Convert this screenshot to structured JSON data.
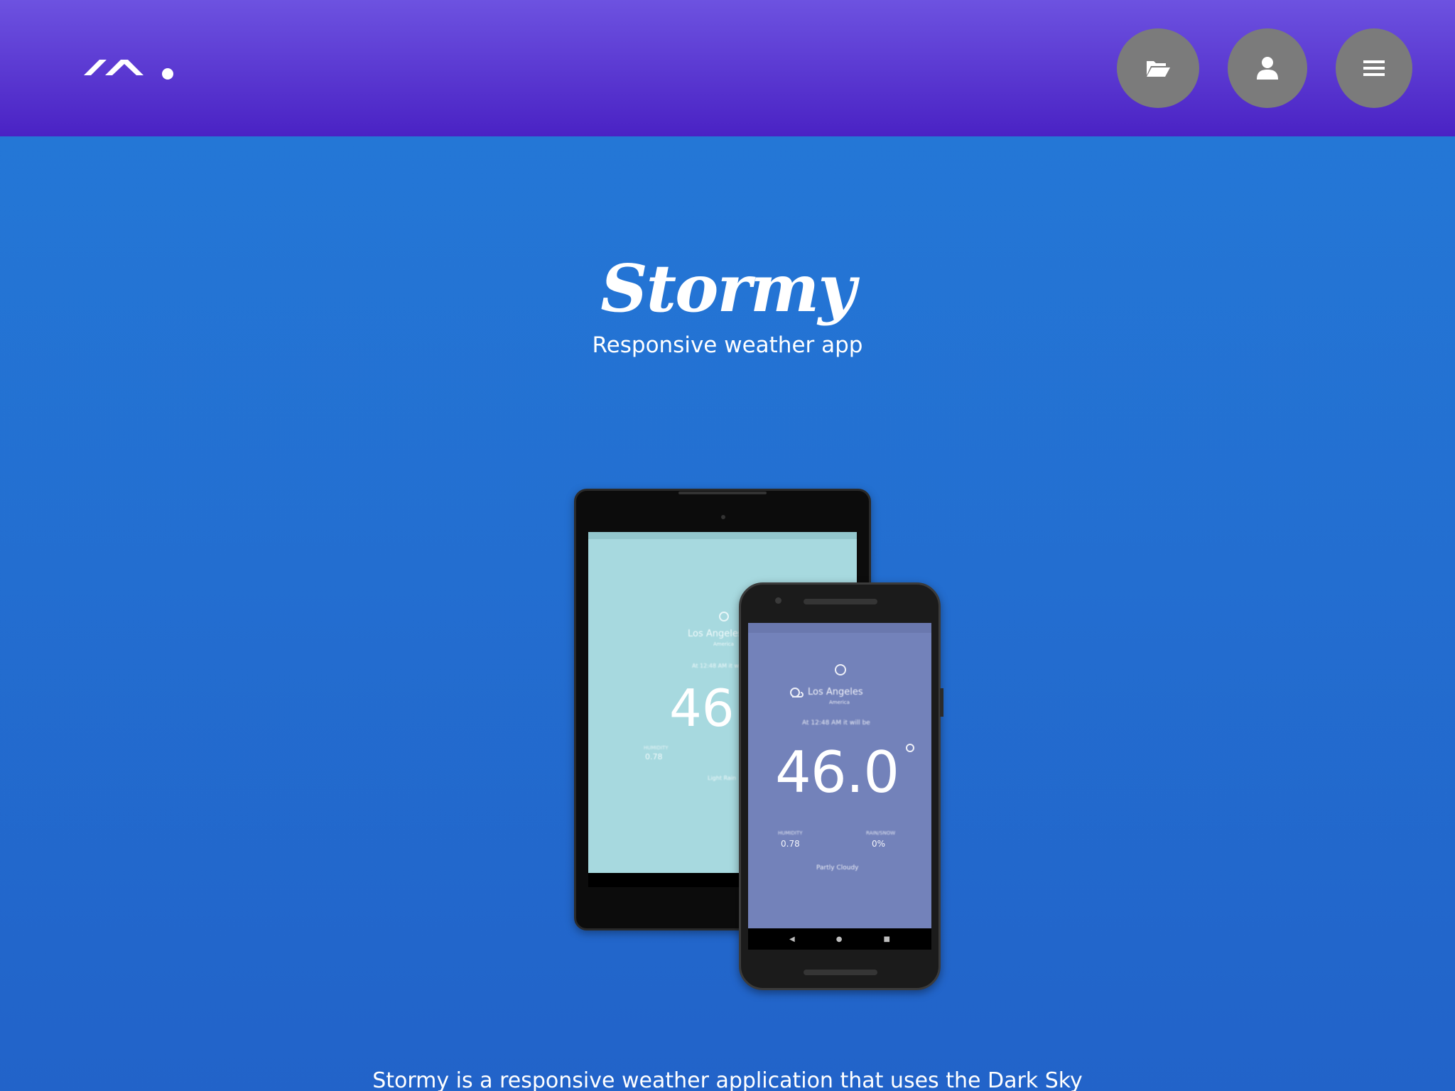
{
  "header": {
    "logo_icon": "brand-logo-mark",
    "buttons": [
      {
        "icon": "folder-open-icon",
        "label": "Projects"
      },
      {
        "icon": "user-icon",
        "label": "About"
      },
      {
        "icon": "hamburger-menu-icon",
        "label": "Menu"
      }
    ],
    "colors": {
      "header_top": "#6d52e0",
      "header_bottom": "#4a22c4",
      "button": "#7b7b7b"
    }
  },
  "hero": {
    "title": "Stormy",
    "subtitle": "Responsive weather app"
  },
  "tablet_app": {
    "city": "Los Angeles",
    "country": "America",
    "time_text": "At 12:48 AM it will be",
    "temperature": "46.",
    "humidity_label": "HUMIDITY",
    "humidity": "0.78",
    "summary": "Light Rain",
    "screen_color": "#a7d9df"
  },
  "phone_app": {
    "city": "Los Angeles",
    "country": "America",
    "time_text": "At 12:48 AM it will be",
    "temperature": "46.0",
    "humidity_label": "HUMIDITY",
    "humidity": "0.78",
    "rain_label": "RAIN/SNOW",
    "rain": "0%",
    "summary": "Partly Cloudy",
    "screen_color": "#7382ba"
  },
  "description": "Stormy is a responsive weather application that uses the Dark Sky",
  "page": {
    "background_top": "#247ad8",
    "background_bottom": "#2263c9"
  }
}
